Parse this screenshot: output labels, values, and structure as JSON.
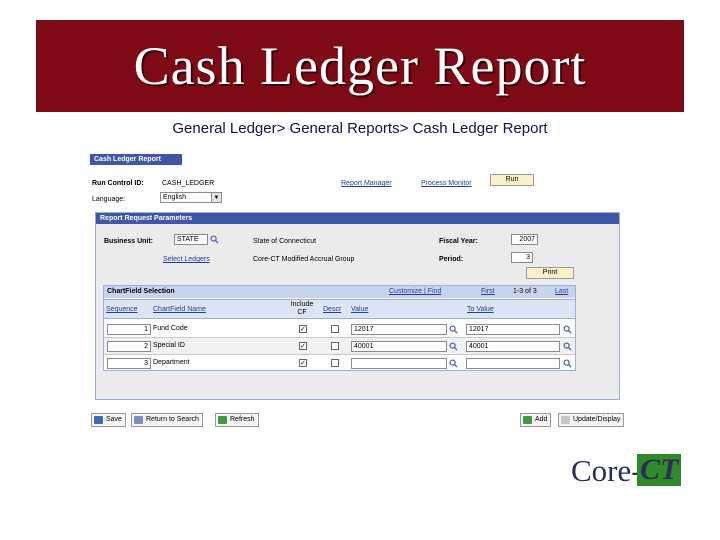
{
  "banner": {
    "title": "Cash Ledger Report"
  },
  "breadcrumb": "General Ledger> General Reports> Cash Ledger Report",
  "page_tab": "Cash Ledger Report",
  "header": {
    "run_control_label": "Run Control ID:",
    "run_control_value": "CASH_LEDGER",
    "report_manager": "Report Manager",
    "process_monitor": "Process Monitor",
    "run_button": "Run",
    "language_label": "Language:",
    "language_value": "English"
  },
  "params": {
    "title": "Report Request Parameters",
    "business_unit_label": "Business Unit:",
    "business_unit_value": "STATE",
    "business_unit_desc": "State of Connecticut",
    "fiscal_year_label": "Fiscal Year:",
    "fiscal_year_value": "2007",
    "select_ledgers": "Select Ledgers",
    "ledger_group_desc": "Core-CT Modified Accrual Group",
    "period_label": "Period:",
    "period_value": "3",
    "print_button": "Print"
  },
  "grid": {
    "title": "ChartField Selection",
    "customize": "Customize | Find",
    "nav_first": "First",
    "nav_range": "1-3 of 3",
    "nav_last": "Last",
    "columns": {
      "sequence": "Sequence",
      "chartfield": "ChartField Name",
      "include": "Include CF",
      "descr": "Descr",
      "value": "Value",
      "to_value": "To Value"
    },
    "rows": [
      {
        "seq": "1",
        "name": "Fund Code",
        "include": true,
        "descr": false,
        "value": "12017",
        "to_value": "12017"
      },
      {
        "seq": "2",
        "name": "Special ID",
        "include": true,
        "descr": false,
        "value": "40001",
        "to_value": "40001"
      },
      {
        "seq": "3",
        "name": "Department",
        "include": true,
        "descr": false,
        "value": "",
        "to_value": ""
      }
    ]
  },
  "toolbar": {
    "save": "Save",
    "return_to_search": "Return to Search",
    "refresh": "Refresh",
    "add": "Add",
    "update_display": "Update/Display"
  },
  "logo": {
    "text_core": "Core-",
    "text_ct": "CT"
  },
  "colors": {
    "banner": "#7d0a14",
    "tab": "#3f57a6",
    "link": "#1f3ea0",
    "logo_green": "#2f8a2a"
  }
}
